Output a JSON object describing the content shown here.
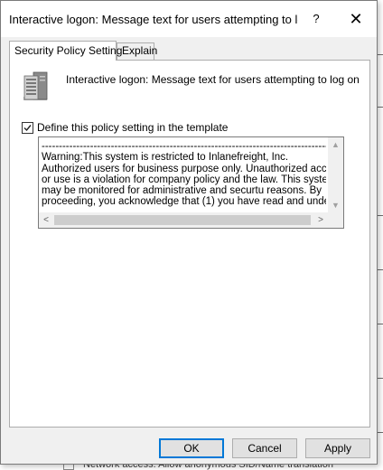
{
  "window": {
    "title": "Interactive logon: Message text for users attempting to lo...",
    "help_glyph": "?",
    "close_glyph": "✕"
  },
  "tabs": [
    {
      "label": "Security Policy Setting",
      "active": true
    },
    {
      "label": "Explain",
      "active": false
    }
  ],
  "policy": {
    "icon": "server-icon",
    "title": "Interactive logon: Message text for users attempting to log on"
  },
  "define": {
    "checked": true,
    "check_glyph": "✓",
    "label": "Define this policy setting in the template"
  },
  "message_text": "------------------------------------------------------------------------------------------------\nWarning:This system is restricted to Inlanefreight, Inc.\nAuthorized users for business purpose only. Unauthorized access\nor use is a violation for company policy and the law. This system\nmay be monitored for administrative and securtu reasons. By\nproceeding, you acknowledge that (1) you have read and understand",
  "scrollbar": {
    "up": "▲",
    "down": "▼",
    "left": "<",
    "right": ">"
  },
  "buttons": {
    "ok": "OK",
    "cancel": "Cancel",
    "apply": "Apply"
  },
  "background": {
    "bottom_text": "Network access: Allow anonymous SID/Name translation"
  }
}
